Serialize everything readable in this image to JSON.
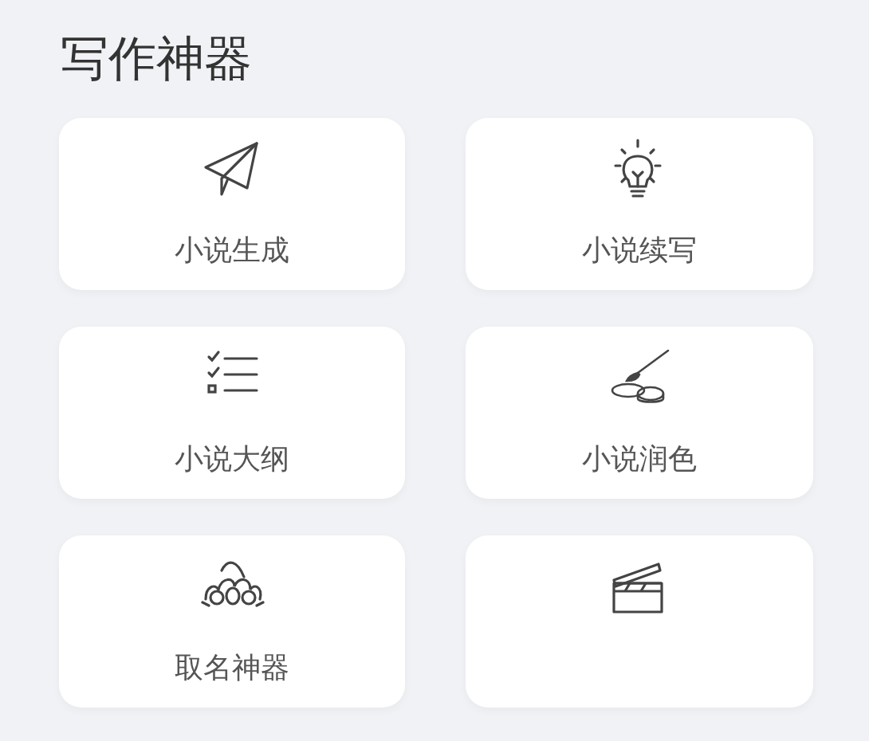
{
  "section": {
    "title": "写作神器"
  },
  "tools": [
    {
      "kind": "labeled",
      "label": "小说生成"
    },
    {
      "kind": "labeled",
      "label": "小说续写"
    },
    {
      "kind": "labeled",
      "label": "小说大纲"
    },
    {
      "kind": "labeled",
      "label": "小说润色"
    },
    {
      "kind": "labeled",
      "label": "取名神器"
    },
    {
      "kind": "icon_only"
    }
  ]
}
